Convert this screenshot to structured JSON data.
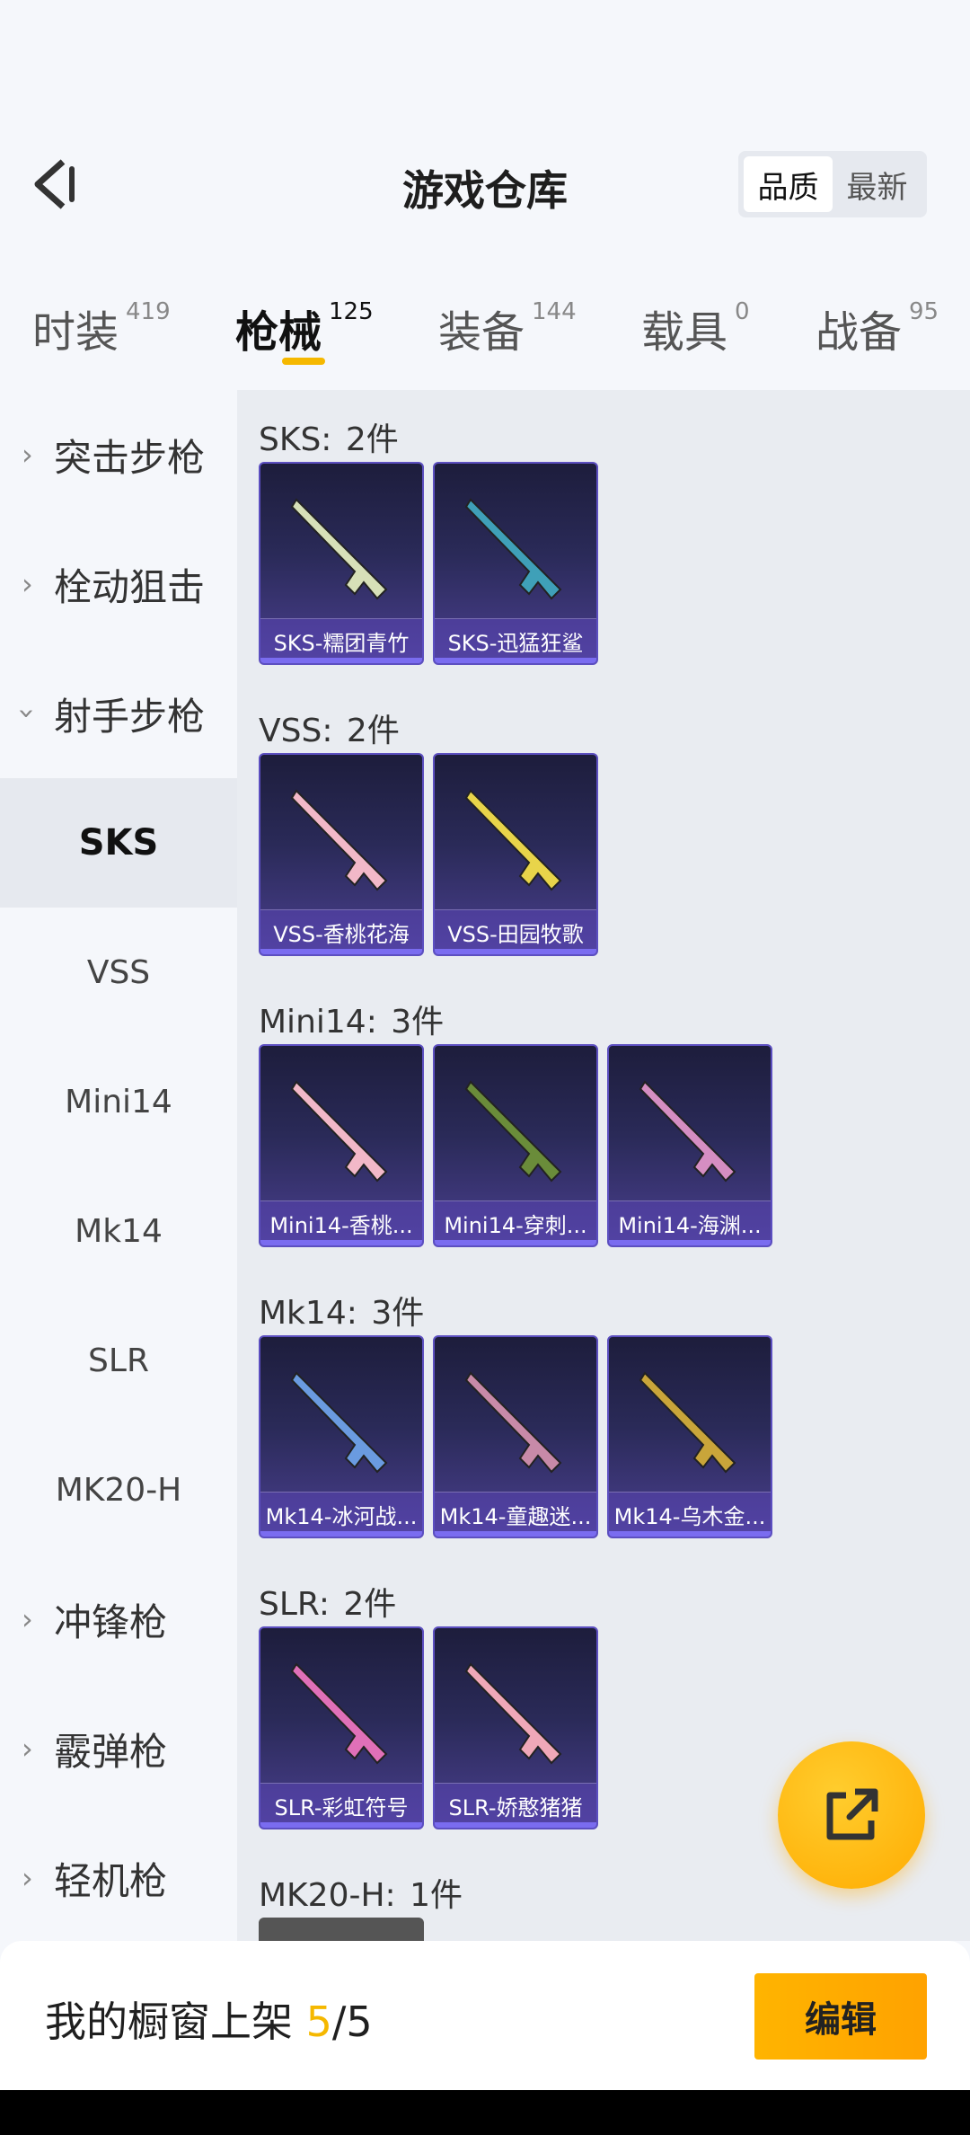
{
  "header": {
    "title": "游戏仓库",
    "sort": [
      "品质",
      "最新"
    ]
  },
  "tabs": [
    {
      "label": "时装",
      "count": "419"
    },
    {
      "label": "枪械",
      "count": "125"
    },
    {
      "label": "装备",
      "count": "144"
    },
    {
      "label": "载具",
      "count": "0"
    },
    {
      "label": "战备",
      "count": "95"
    }
  ],
  "sidebar": {
    "categories": [
      "突击步枪",
      "栓动狙击",
      "射手步枪",
      "冲锋枪",
      "霰弹枪",
      "轻机枪"
    ],
    "subitems": [
      "SKS",
      "VSS",
      "Mini14",
      "Mk14",
      "SLR",
      "MK20-H"
    ]
  },
  "sections": [
    {
      "title": "SKS:",
      "count": "2件",
      "items": [
        "SKS-糯团青竹",
        "SKS-迅猛狂鲨"
      ]
    },
    {
      "title": "VSS:",
      "count": "2件",
      "items": [
        "VSS-香桃花海",
        "VSS-田园牧歌"
      ]
    },
    {
      "title": "Mini14:",
      "count": "3件",
      "items": [
        "Mini14-香桃...",
        "Mini14-穿刺...",
        "Mini14-海渊..."
      ]
    },
    {
      "title": "Mk14:",
      "count": "3件",
      "items": [
        "Mk14-冰河战...",
        "Mk14-童趣迷...",
        "Mk14-乌木金..."
      ]
    },
    {
      "title": "SLR:",
      "count": "2件",
      "items": [
        "SLR-彩虹符号",
        "SLR-娇憨猪猪"
      ]
    },
    {
      "title": "MK20-H:",
      "count": "1件",
      "items": []
    }
  ],
  "bottom": {
    "label": "我的橱窗上架",
    "current": "5",
    "total": "/5",
    "edit": "编辑"
  },
  "colors": {
    "accent": "#f5b800",
    "card": "#2a2a58"
  }
}
